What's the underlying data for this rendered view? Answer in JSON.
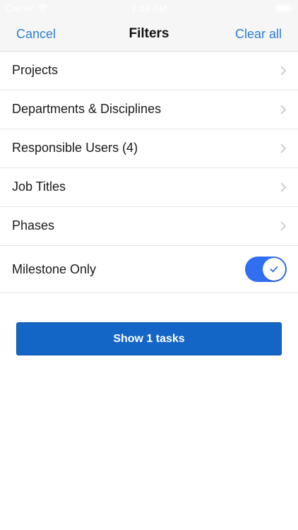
{
  "status_bar": {
    "carrier": "Carrier",
    "time": "7:48 AM"
  },
  "nav": {
    "cancel_label": "Cancel",
    "title": "Filters",
    "clear_label": "Clear all"
  },
  "filters": [
    {
      "label": "Projects"
    },
    {
      "label": "Departments & Disciplines"
    },
    {
      "label": "Responsible Users (4)"
    },
    {
      "label": "Job Titles"
    },
    {
      "label": "Phases"
    }
  ],
  "milestone": {
    "label": "Milestone Only",
    "enabled": true
  },
  "show_button_label": "Show 1 tasks",
  "colors": {
    "accent_link": "#2e7ed6",
    "toggle_on": "#2f6ff0",
    "primary_button": "#1366c6"
  }
}
